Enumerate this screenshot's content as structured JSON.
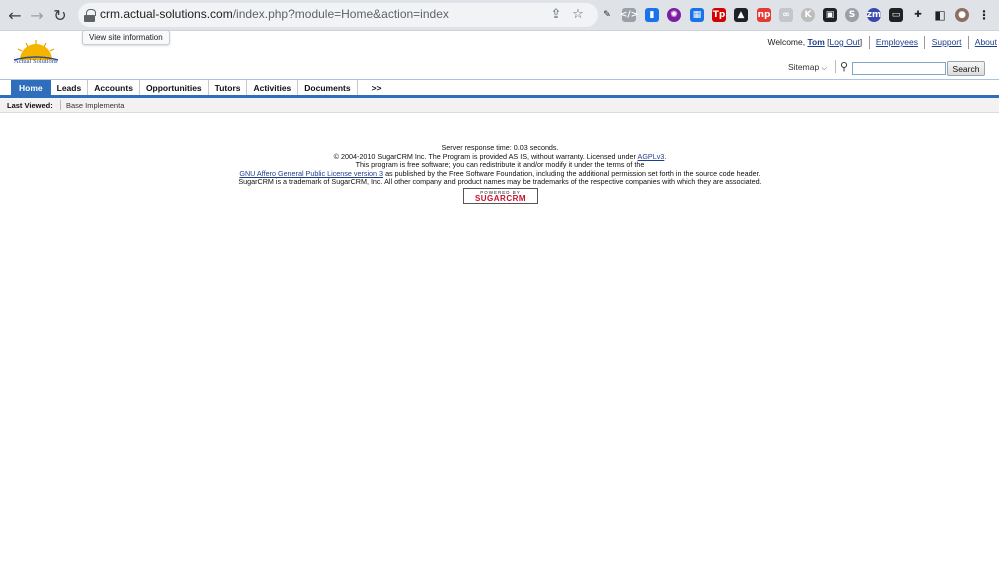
{
  "browser": {
    "url_host": "crm.actual-solutions.com",
    "url_path": "/index.php?module=Home&action=index",
    "tooltip": "View site information"
  },
  "header": {
    "logo_text": "Actual Solutions",
    "welcome": "Welcome,",
    "user": "Tom",
    "logout_open": "[",
    "logout": "Log Out",
    "logout_close": "]",
    "links": [
      "Employees",
      "Support",
      "About"
    ],
    "sitemap": "Sitemap",
    "search_button": "Search",
    "search_value": ""
  },
  "tabs": [
    "Home",
    "Leads",
    "Accounts",
    "Opportunities",
    "Tutors",
    "Activities",
    "Documents",
    ">>"
  ],
  "last_viewed": {
    "label": "Last Viewed:",
    "item": "Base Implementa"
  },
  "footer": {
    "response": "Server response time: 0.03 seconds.",
    "line2_pre": "© 2004-2010 SugarCRM Inc. The Program is provided AS IS, without warranty. Licensed under",
    "line2_link": "AGPLv3",
    "line3": "This program is free software; you can redistribute it and/or modify it under the terms of the",
    "line4_link": "GNU Affero General Public License version 3",
    "line4_post": "as published by the Free Software Foundation, including the additional permission set forth in the source code header.",
    "line5": "SugarCRM is a trademark of SugarCRM, Inc. All other company and product names may be trademarks of the respective companies with which they are associated.",
    "powered_by": "POWERED BY",
    "sugar": "SUGARCRM"
  },
  "colors": {
    "accent": "#2f6eba",
    "link": "#1f3f8c"
  }
}
